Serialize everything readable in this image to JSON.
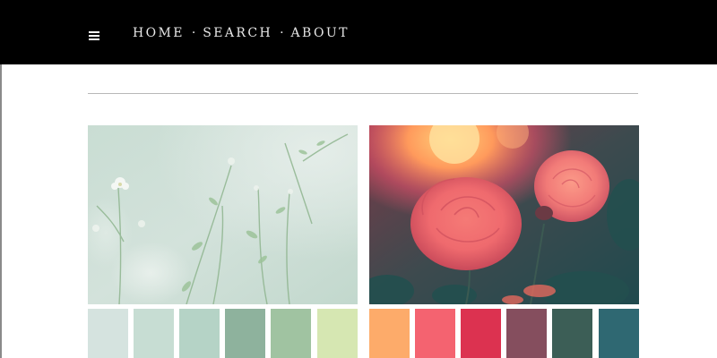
{
  "nav": {
    "menu_icon": "hamburger-menu-icon",
    "links": [
      "HOME",
      "SEARCH",
      "ABOUT"
    ],
    "separator": "·"
  },
  "palettes": {
    "left": [
      "#d5e3df",
      "#c7ddd3",
      "#b5d3c6",
      "#8eb29d",
      "#a0c3a1",
      "#d6e7b2"
    ],
    "right": [
      "#fdab6a",
      "#f46370",
      "#dc3250",
      "#854e5e",
      "#3c5e56",
      "#2f6872"
    ]
  }
}
